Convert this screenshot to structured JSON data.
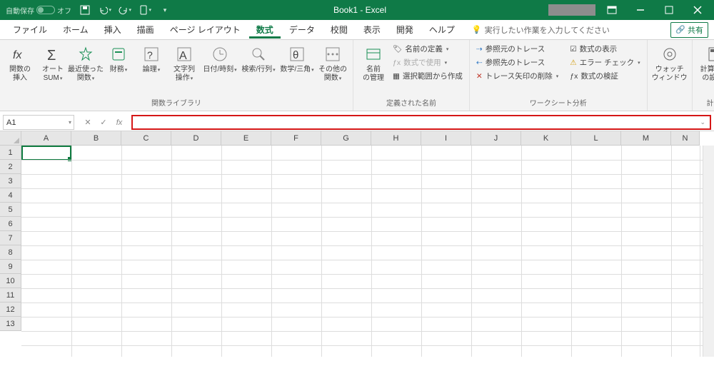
{
  "titlebar": {
    "autosave_label": "自動保存",
    "autosave_state": "オフ",
    "document_title": "Book1  -  Excel"
  },
  "qa_icons": [
    "save",
    "undo",
    "redo",
    "touch"
  ],
  "window_controls": [
    "ribbon-display",
    "min",
    "max",
    "close"
  ],
  "tabs": {
    "file": "ファイル",
    "home": "ホーム",
    "insert": "挿入",
    "draw": "描画",
    "page_layout": "ページ レイアウト",
    "formulas": "数式",
    "data": "データ",
    "review": "校閲",
    "view": "表示",
    "developer": "開発",
    "help": "ヘルプ",
    "tell_me": "実行したい作業を入力してください",
    "share": "共有"
  },
  "ribbon": {
    "insert_function": "関数の\n挿入",
    "autosum": "オート\nSUM",
    "recent": "最近使った\n関数",
    "financial": "財務",
    "logical": "論理",
    "text": "文字列\n操作",
    "datetime": "日付/時刻",
    "lookup": "検索/行列",
    "math": "数学/三角",
    "more": "その他の\n関数",
    "group_lib": "関数ライブラリ",
    "name_mgr": "名前\nの管理",
    "define_name": "名前の定義",
    "use_in_formula": "数式で使用",
    "create_from_sel": "選択範囲から作成",
    "group_names": "定義された名前",
    "trace_prec": "参照元のトレース",
    "trace_dep": "参照先のトレース",
    "remove_arrows": "トレース矢印の削除",
    "show_formulas": "数式の表示",
    "error_check": "エラー チェック",
    "evaluate": "数式の検証",
    "group_audit": "ワークシート分析",
    "watch": "ウォッチ\nウィンドウ",
    "calc_opts": "計算方法\nの設定",
    "group_calc": "計算方法"
  },
  "name_box": {
    "value": "A1"
  },
  "formula_bar": {
    "value": ""
  },
  "columns": [
    "A",
    "B",
    "C",
    "D",
    "E",
    "F",
    "G",
    "H",
    "I",
    "J",
    "K",
    "L",
    "M",
    "N"
  ],
  "rows": [
    "1",
    "2",
    "3",
    "4",
    "5",
    "6",
    "7",
    "8",
    "9",
    "10",
    "11",
    "12",
    "13"
  ]
}
